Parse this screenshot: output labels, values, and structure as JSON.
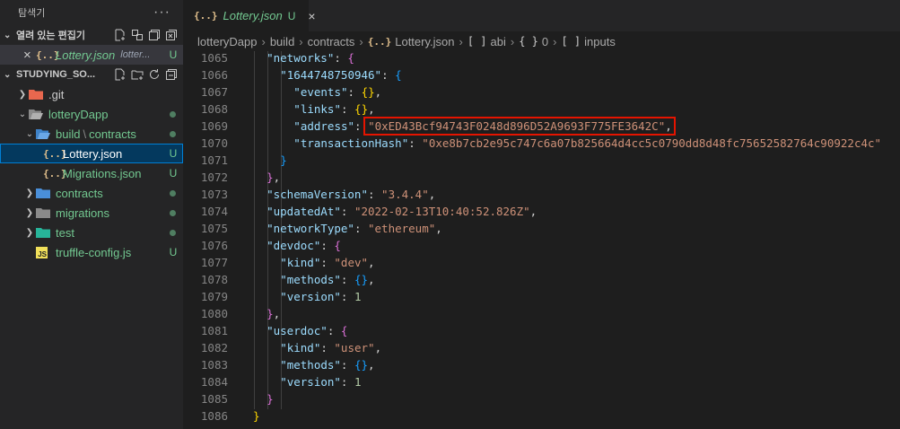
{
  "sidebar": {
    "title": "탐색기",
    "more_glyph": "···",
    "open_editors": {
      "label": "열려 있는 편집기",
      "items": [
        {
          "close": "×",
          "icon": "{..}",
          "name": "Lottery.json",
          "path": "lotter...",
          "badge": "U"
        }
      ]
    },
    "workspace": {
      "label": "STUDYING_SO...",
      "tree": [
        {
          "name": ".git",
          "badge": "",
          "depth": 1
        },
        {
          "name": "lotteryDapp",
          "badge": "dot",
          "depth": 1
        },
        {
          "name": "build",
          "name2": "contracts",
          "badge": "dot",
          "depth": 2
        },
        {
          "name": "Lottery.json",
          "badge": "U",
          "depth": 3
        },
        {
          "name": "Migrations.json",
          "badge": "U",
          "depth": 3
        },
        {
          "name": "contracts",
          "badge": "dot",
          "depth": 2
        },
        {
          "name": "migrations",
          "badge": "dot",
          "depth": 2
        },
        {
          "name": "test",
          "badge": "dot",
          "depth": 2
        },
        {
          "name": "truffle-config.js",
          "badge": "U",
          "depth": 2
        }
      ]
    }
  },
  "tab": {
    "icon": "{..}",
    "name": "Lottery.json",
    "status": "U",
    "close": "×"
  },
  "breadcrumb": [
    "lotteryDapp",
    "build",
    "contracts",
    "Lottery.json",
    "abi",
    "0",
    "inputs"
  ],
  "breadcrumb_icons": {
    "json": "{..}",
    "array": "[ ]",
    "object": "{ }"
  },
  "editor": {
    "line_numbers": [
      "1065",
      "1066",
      "1067",
      "1068",
      "1069",
      "1070",
      "1071",
      "1072",
      "1073",
      "1074",
      "1075",
      "1076",
      "1077",
      "1078",
      "1079",
      "1080",
      "1081",
      "1082",
      "1083",
      "1084",
      "1085",
      "1086"
    ],
    "lines": [
      "\"networks\": {",
      "\"1644748750946\": {",
      "\"events\": {},",
      "\"links\": {},",
      "\"address\": \"0xED43Bcf94743F0248d896D52A9693F775FE3642C\",",
      "\"transactionHash\": \"0xe8b7cb2e95c747c6a07b825664d4cc5c0790dd8d48fc75652582764c90922c4c\"",
      "}",
      "},",
      "\"schemaVersion\": \"3.4.4\",",
      "\"updatedAt\": \"2022-02-13T10:40:52.826Z\",",
      "\"networkType\": \"ethereum\",",
      "\"devdoc\": {",
      "\"kind\": \"dev\",",
      "\"methods\": {},",
      "\"version\": 1",
      "},",
      "\"userdoc\": {",
      "\"kind\": \"user\",",
      "\"methods\": {},",
      "\"version\": 1",
      "}",
      "}"
    ]
  },
  "colors": {
    "accent": "#007fd4",
    "highlight_box": "#e51400",
    "untracked": "#73c991"
  }
}
